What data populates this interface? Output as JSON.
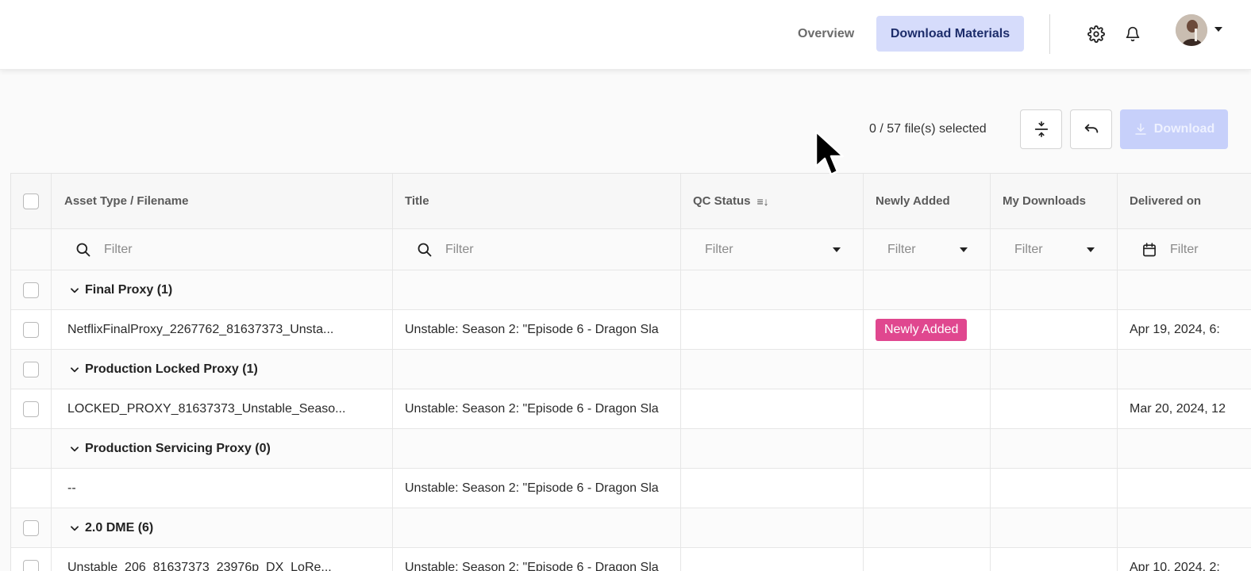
{
  "nav": {
    "overview": "Overview",
    "download_materials": "Download Materials",
    "settings_icon": "gear-icon",
    "notifications_icon": "bell-icon"
  },
  "toolbar": {
    "selected_count": "0 / 57 file(s) selected",
    "download_label": "Download",
    "collapse_icon": "collapse-rows-icon",
    "undo_icon": "undo-icon"
  },
  "table": {
    "columns": [
      "Asset Type / Filename",
      "Title",
      "QC Status",
      "Newly Added",
      "My Downloads",
      "Delivered on"
    ],
    "filter_placeholder": "Filter",
    "rows": [
      {
        "kind": "group",
        "label": "Final Proxy (1)",
        "checkbox": true
      },
      {
        "kind": "data",
        "filename": "NetflixFinalProxy_2267762_81637373_Unsta...",
        "title": "Unstable: Season 2: \"Episode 6 - Dragon Sla",
        "qc": "",
        "newly_added": "Newly Added",
        "my_downloads": "",
        "delivered": "Apr 19, 2024, 6:",
        "checkbox": true
      },
      {
        "kind": "group",
        "label": "Production Locked Proxy (1)",
        "checkbox": true
      },
      {
        "kind": "data",
        "filename": "LOCKED_PROXY_81637373_Unstable_Seaso...",
        "title": "Unstable: Season 2: \"Episode 6 - Dragon Sla",
        "qc": "",
        "newly_added": "",
        "my_downloads": "",
        "delivered": "Mar 20, 2024, 12",
        "checkbox": true
      },
      {
        "kind": "group",
        "label": "Production Servicing Proxy (0)",
        "checkbox": false
      },
      {
        "kind": "data",
        "filename": "--",
        "title": "Unstable: Season 2: \"Episode 6 - Dragon Sla",
        "qc": "",
        "newly_added": "",
        "my_downloads": "",
        "delivered": "",
        "checkbox": false
      },
      {
        "kind": "group",
        "label": "2.0 DME (6)",
        "checkbox": true
      },
      {
        "kind": "data",
        "filename": "Unstable_206_81637373_23976p_DX_LoRe...",
        "title": "Unstable: Season 2: \"Episode 6 - Dragon Sla",
        "qc": "",
        "newly_added": "",
        "my_downloads": "",
        "delivered": "Apr 10, 2024, 2:",
        "checkbox": true
      }
    ]
  },
  "colors": {
    "accent_active_nav": "#d6dcfb",
    "download_disabled": "#c7d0fa",
    "badge_pink": "#e0478f"
  }
}
